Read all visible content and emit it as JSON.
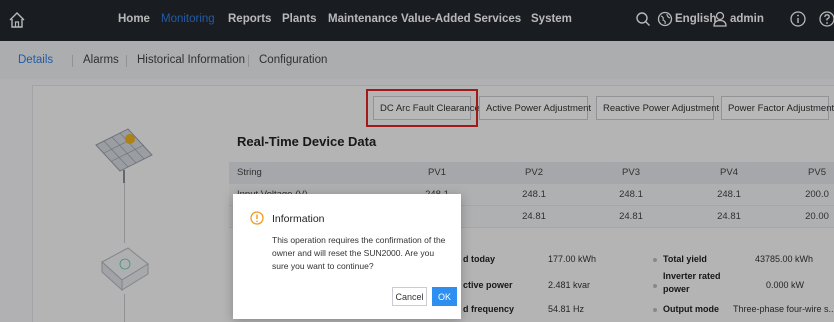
{
  "nav": {
    "items": [
      "Home",
      "Monitoring",
      "Reports",
      "Plants",
      "Maintenance",
      "Value-Added Services",
      "System"
    ],
    "language": "English",
    "user": "admin"
  },
  "tabs": [
    "Details",
    "Alarms",
    "Historical Information",
    "Configuration"
  ],
  "actions": [
    "DC Arc Fault Clearance",
    "Active Power Adjustment",
    "Reactive Power Adjustment",
    "Power Factor Adjustment"
  ],
  "section_title": "Real-Time Device Data",
  "table": {
    "headers": [
      "String",
      "PV1",
      "PV2",
      "PV3",
      "PV4",
      "PV5"
    ],
    "rows": [
      [
        "Input Voltage (V)",
        "248.1",
        "248.1",
        "248.1",
        "248.1",
        "200.0"
      ],
      [
        "",
        "24.81",
        "24.81",
        "24.81",
        "24.81",
        "20.00"
      ]
    ]
  },
  "kv": {
    "yield_today_label": "d today",
    "yield_today_value": "177.00 kWh",
    "total_yield_label": "Total yield",
    "total_yield_value": "43785.00 kWh",
    "reactive_label": "ctive power",
    "reactive_value": "2.481 kvar",
    "rated_label": "Inverter rated power",
    "rated_value": "0.000 kW",
    "freq_label": "d frequency",
    "freq_value": "54.81 Hz",
    "mode_label": "Output mode",
    "mode_value": "Three-phase four-wire s..."
  },
  "dialog": {
    "title": "Information",
    "message": "This operation requires the confirmation of the owner and will reset the SUN2000. Are you sure you want to continue?",
    "cancel": "Cancel",
    "ok": "OK"
  },
  "colors": {
    "accent": "#2f7ee8",
    "highlight": "#e02424",
    "topbar": "#23272e"
  }
}
